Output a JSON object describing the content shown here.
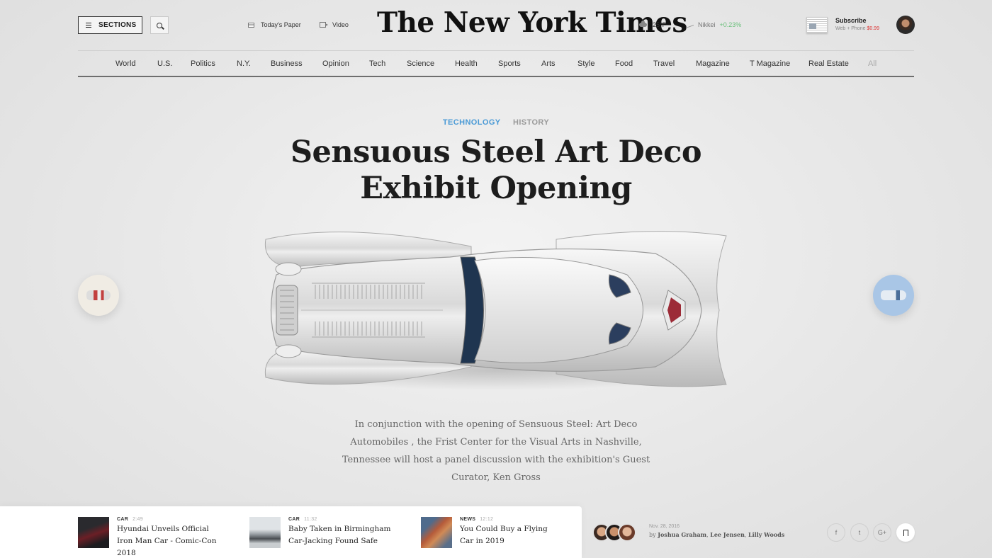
{
  "header": {
    "sections_label": "SECTIONS",
    "todays_paper": "Today's Paper",
    "video": "Video",
    "logo": "The New York Times",
    "weather": "25°F",
    "market_name": "Nikkei",
    "market_change": "+0.23%",
    "subscribe_title": "Subscribe",
    "subscribe_desc": "Web + Phone",
    "subscribe_price": "$0.99"
  },
  "nav": {
    "items": [
      "World",
      "U.S.",
      "Politics",
      "N.Y.",
      "Business",
      "Opinion",
      "Tech",
      "Science",
      "Health",
      "Sports",
      "Arts",
      "Style",
      "Food",
      "Travel",
      "Magazine",
      "T Magazine",
      "Real Estate",
      "All"
    ]
  },
  "article": {
    "tags": [
      "TECHNOLOGY",
      "HISTORY"
    ],
    "headline_line1": "Sensuous Steel Art Deco",
    "headline_line2": "Exhibit Opening",
    "lede": "In conjunction with the opening of Sensuous Steel: Art Deco Automobiles , the Frist Center for the Visual Arts in Nashville, Tennessee will host a panel discussion with the exhibition's Guest Curator, Ken Gross",
    "date": "Nov. 28, 2016",
    "by": "by",
    "authors": [
      "Joshua Graham",
      "Lee Jensen",
      "Lilly Woods"
    ]
  },
  "stories": [
    {
      "category": "CAR",
      "time": "2:49",
      "title": "Hyundai Unveils Official Iron Man Car - Comic-Con 2018"
    },
    {
      "category": "CAR",
      "time": "11:32",
      "title": "Baby Taken in Birmingham Car-Jacking Found Safe"
    },
    {
      "category": "NEWS",
      "time": "12:12",
      "title": "You Could Buy a Flying Car in 2019"
    }
  ],
  "share": {
    "facebook": "f",
    "twitter": "t",
    "google": "G+"
  },
  "colors": {
    "accent": "#4a9ad6",
    "up": "#6cc07c",
    "price": "#dd3333"
  }
}
